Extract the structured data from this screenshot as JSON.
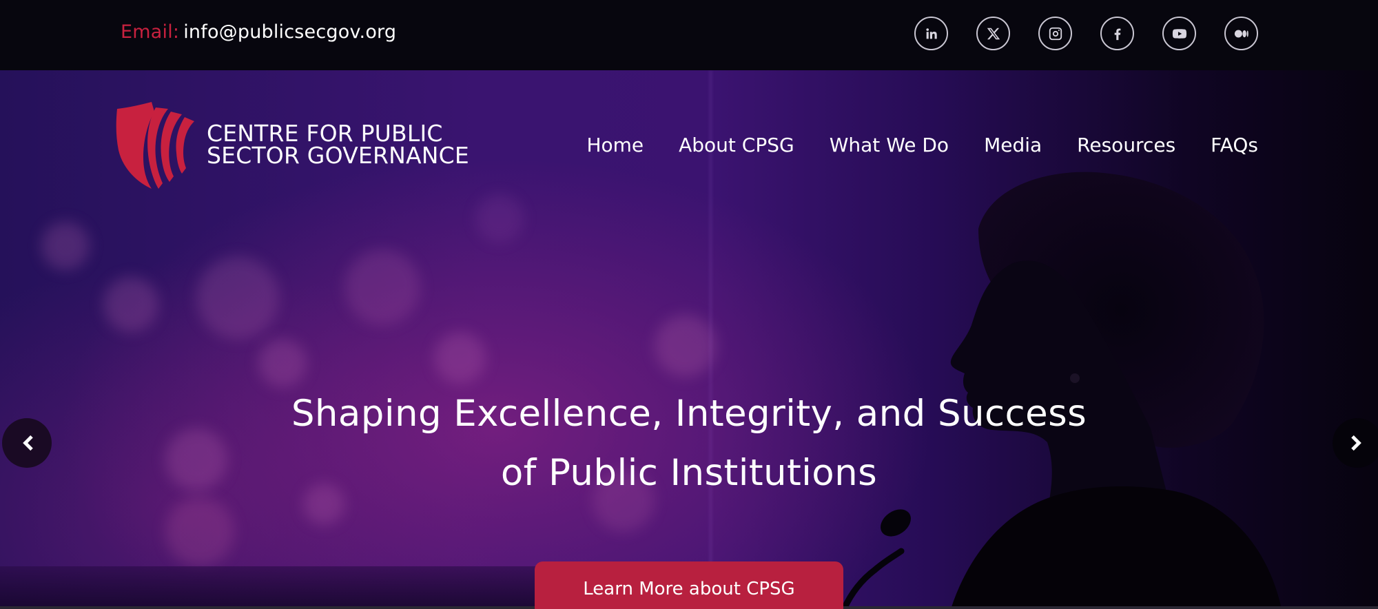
{
  "topbar": {
    "email_label": "Email:",
    "email_value": "info@publicsecgov.org",
    "socials": [
      {
        "icon": "linkedin-icon",
        "label": "in"
      },
      {
        "icon": "x-twitter-icon"
      },
      {
        "icon": "instagram-icon"
      },
      {
        "icon": "facebook-icon"
      },
      {
        "icon": "youtube-icon"
      },
      {
        "icon": "medium-icon"
      }
    ]
  },
  "brand": {
    "line1": "CENTRE FOR PUBLIC",
    "line2": "SECTOR GOVERNANCE",
    "logo_color": "#c8213f"
  },
  "nav": {
    "items": [
      {
        "label": "Home"
      },
      {
        "label": "About CPSG"
      },
      {
        "label": "What We Do"
      },
      {
        "label": "Media"
      },
      {
        "label": "Resources"
      },
      {
        "label": "FAQs"
      }
    ]
  },
  "hero": {
    "headline_line1": "Shaping Excellence, Integrity, and Success",
    "headline_line2": "of Public Institutions",
    "cta_label": "Learn More about CPSG",
    "prev_icon": "chevron-left-icon",
    "next_icon": "chevron-right-icon"
  },
  "colors": {
    "accent": "#b8203f",
    "topbar_bg": "#07060e",
    "hero_purple": "#3b1370"
  }
}
